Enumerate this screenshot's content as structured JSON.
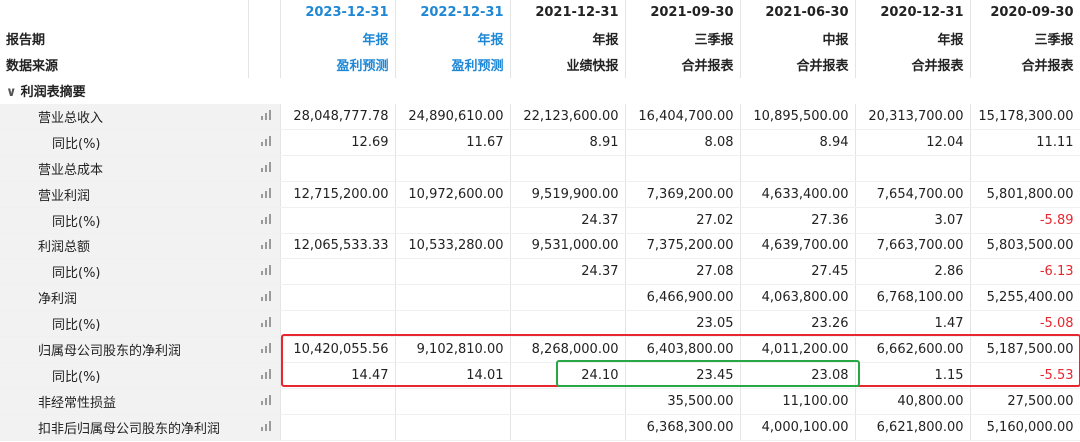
{
  "header": {
    "row_labels": [
      "报告期",
      "数据来源"
    ],
    "columns": [
      {
        "period": "2023-12-31",
        "type": "年报",
        "source": "盈利预测",
        "highlight": true
      },
      {
        "period": "2022-12-31",
        "type": "年报",
        "source": "盈利预测",
        "highlight": true
      },
      {
        "period": "2021-12-31",
        "type": "年报",
        "source": "业绩快报",
        "highlight": false
      },
      {
        "period": "2021-09-30",
        "type": "三季报",
        "source": "合并报表",
        "highlight": false
      },
      {
        "period": "2021-06-30",
        "type": "中报",
        "source": "合并报表",
        "highlight": false
      },
      {
        "period": "2020-12-31",
        "type": "年报",
        "source": "合并报表",
        "highlight": false
      },
      {
        "period": "2020-09-30",
        "type": "三季报",
        "source": "合并报表",
        "highlight": false
      }
    ]
  },
  "section": {
    "title": "利润表摘要"
  },
  "rows": [
    {
      "label": "营业总收入",
      "sub": false,
      "values": [
        "28,048,777.78",
        "24,890,610.00",
        "22,123,600.00",
        "16,404,700.00",
        "10,895,500.00",
        "20,313,700.00",
        "15,178,300.00"
      ]
    },
    {
      "label": "同比(%)",
      "sub": true,
      "values": [
        "12.69",
        "11.67",
        "8.91",
        "8.08",
        "8.94",
        "12.04",
        "11.11"
      ]
    },
    {
      "label": "营业总成本",
      "sub": false,
      "values": [
        "",
        "",
        "",
        "",
        "",
        "",
        ""
      ]
    },
    {
      "label": "营业利润",
      "sub": false,
      "values": [
        "12,715,200.00",
        "10,972,600.00",
        "9,519,900.00",
        "7,369,200.00",
        "4,633,400.00",
        "7,654,700.00",
        "5,801,800.00"
      ]
    },
    {
      "label": "同比(%)",
      "sub": true,
      "values": [
        "",
        "",
        "24.37",
        "27.02",
        "27.36",
        "3.07",
        "-5.89"
      ]
    },
    {
      "label": "利润总额",
      "sub": false,
      "values": [
        "12,065,533.33",
        "10,533,280.00",
        "9,531,000.00",
        "7,375,200.00",
        "4,639,700.00",
        "7,663,700.00",
        "5,803,500.00"
      ]
    },
    {
      "label": "同比(%)",
      "sub": true,
      "values": [
        "",
        "",
        "24.37",
        "27.08",
        "27.45",
        "2.86",
        "-6.13"
      ]
    },
    {
      "label": "净利润",
      "sub": false,
      "values": [
        "",
        "",
        "",
        "6,466,900.00",
        "4,063,800.00",
        "6,768,100.00",
        "5,255,400.00"
      ]
    },
    {
      "label": "同比(%)",
      "sub": true,
      "values": [
        "",
        "",
        "",
        "23.05",
        "23.26",
        "1.47",
        "-5.08"
      ]
    },
    {
      "label": "归属母公司股东的净利润",
      "sub": false,
      "values": [
        "10,420,055.56",
        "9,102,810.00",
        "8,268,000.00",
        "6,403,800.00",
        "4,011,200.00",
        "6,662,600.00",
        "5,187,500.00"
      ]
    },
    {
      "label": "同比(%)",
      "sub": true,
      "values": [
        "14.47",
        "14.01",
        "24.10",
        "23.45",
        "23.08",
        "1.15",
        "-5.53"
      ]
    },
    {
      "label": "非经常性损益",
      "sub": false,
      "values": [
        "",
        "",
        "",
        "35,500.00",
        "11,100.00",
        "40,800.00",
        "27,500.00"
      ]
    },
    {
      "label": "扣非后归属母公司股东的净利润",
      "sub": false,
      "values": [
        "",
        "",
        "",
        "6,368,300.00",
        "4,000,100.00",
        "6,621,800.00",
        "5,160,000.00"
      ]
    }
  ],
  "colors": {
    "header_blue": "#1e88d6",
    "negative_red": "#e8262f",
    "highlight_red_box": "#e8262f",
    "highlight_green_box": "#27a844"
  },
  "icons": {
    "row_chart": "bar-chart-icon",
    "section_toggle": "chevron-down-icon"
  }
}
